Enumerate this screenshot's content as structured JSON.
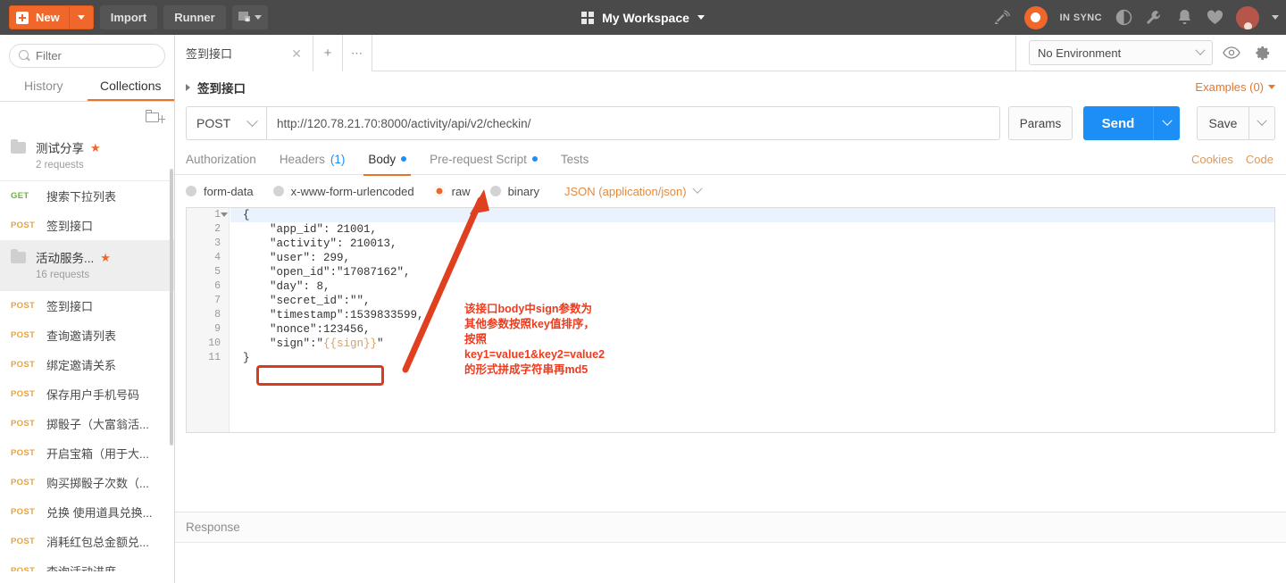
{
  "topbar": {
    "new_label": "New",
    "import_label": "Import",
    "runner_label": "Runner",
    "new_icon": "plus-square-icon",
    "dropdown_icon": "caret-down-icon",
    "import_window_icon": "new-window-icon",
    "workspace_title": "My Workspace",
    "workspace_icon": "grid-icon",
    "workspace_caret": "caret-down-icon",
    "broadcast_icon": "broadcast-icon",
    "sync_icon": "sync-icon",
    "sync_text": "IN SYNC",
    "moon_icon": "moon-icon",
    "wrench_icon": "wrench-icon",
    "bell_icon": "bell-icon",
    "heart_icon": "heart-icon",
    "avatar_icon": "avatar-icon"
  },
  "sidebar": {
    "search_placeholder": "Filter",
    "search_icon": "search-icon",
    "tabs": [
      {
        "label": "History",
        "active": false
      },
      {
        "label": "Collections",
        "active": true
      }
    ],
    "new_folder_icon": "new-folder-icon",
    "collections": [
      {
        "type": "folder",
        "name": "测试分享",
        "requests_label": "2 requests",
        "starred": true,
        "selected": false,
        "star_icon": "star-icon",
        "folder_icon": "folder-icon"
      },
      {
        "type": "request",
        "method": "GET",
        "name": "搜索下拉列表"
      },
      {
        "type": "request",
        "method": "POST",
        "name": "签到接口"
      },
      {
        "type": "folder",
        "name": "活动服务...",
        "requests_label": "16 requests",
        "starred": true,
        "selected": true,
        "star_icon": "star-icon",
        "folder_icon": "folder-icon"
      },
      {
        "type": "request",
        "method": "POST",
        "name": "签到接口"
      },
      {
        "type": "request",
        "method": "POST",
        "name": "查询邀请列表"
      },
      {
        "type": "request",
        "method": "POST",
        "name": "绑定邀请关系"
      },
      {
        "type": "request",
        "method": "POST",
        "name": "保存用户手机号码"
      },
      {
        "type": "request",
        "method": "POST",
        "name": "掷骰子（大富翁活..."
      },
      {
        "type": "request",
        "method": "POST",
        "name": "开启宝箱（用于大..."
      },
      {
        "type": "request",
        "method": "POST",
        "name": "购买掷骰子次数（..."
      },
      {
        "type": "request",
        "method": "POST",
        "name": "兑换 使用道具兑换..."
      },
      {
        "type": "request",
        "method": "POST",
        "name": "消耗红包总金额兑..."
      },
      {
        "type": "request",
        "method": "POST",
        "name": "查询活动进度"
      }
    ]
  },
  "main": {
    "request_tabs": [
      {
        "label": "签到接口",
        "close_icon": "close-icon",
        "active": true
      }
    ],
    "add_tab_icon": "plus-icon",
    "more_tabs_icon": "ellipsis-icon",
    "environment": {
      "selected": "No Environment",
      "caret_icon": "chevron-down-icon",
      "eye_icon": "eye-icon",
      "gear_icon": "gear-icon"
    },
    "breadcrumb": {
      "expand_icon": "triangle-right-icon",
      "title": "签到接口",
      "examples_label": "Examples (0)",
      "examples_caret": "caret-down-icon"
    },
    "request": {
      "method": "POST",
      "method_caret": "chevron-down-icon",
      "url": "http://120.78.21.70:8000/activity/api/v2/checkin/",
      "params_label": "Params",
      "send_label": "Send",
      "send_caret": "chevron-down-icon",
      "save_label": "Save",
      "save_caret": "chevron-down-icon"
    },
    "request_tabs_row": [
      {
        "label": "Authorization",
        "active": false,
        "dot": false,
        "count": null
      },
      {
        "label": "Headers",
        "active": false,
        "dot": false,
        "count": "(1)"
      },
      {
        "label": "Body",
        "active": true,
        "dot": true,
        "count": null
      },
      {
        "label": "Pre-request Script",
        "active": false,
        "dot": true,
        "count": null
      },
      {
        "label": "Tests",
        "active": false,
        "dot": false,
        "count": null
      }
    ],
    "cookies_label": "Cookies",
    "code_label": "Code",
    "body_options": [
      {
        "label": "form-data",
        "selected": false
      },
      {
        "label": "x-www-form-urlencoded",
        "selected": false
      },
      {
        "label": "raw",
        "selected": true
      },
      {
        "label": "binary",
        "selected": false
      }
    ],
    "content_type": "JSON (application/json)",
    "content_type_caret": "chevron-down-icon",
    "editor": {
      "lines": [
        {
          "n": "1",
          "text": "{"
        },
        {
          "n": "2",
          "text": "    \"app_id\": 21001,"
        },
        {
          "n": "3",
          "text": "    \"activity\": 210013,"
        },
        {
          "n": "4",
          "text": "    \"user\": 299,"
        },
        {
          "n": "5",
          "text": "    \"open_id\":\"17087162\","
        },
        {
          "n": "6",
          "text": "    \"day\": 8,"
        },
        {
          "n": "7",
          "text": "    \"secret_id\":\"\","
        },
        {
          "n": "8",
          "text": "    \"timestamp\":1539833599,"
        },
        {
          "n": "9",
          "text": "    \"nonce\":123456,"
        },
        {
          "n": "10",
          "text": "    \"sign\":\"{{sign}}\""
        },
        {
          "n": "11",
          "text": "}"
        }
      ]
    },
    "response_label": "Response"
  },
  "annotations": {
    "note_text": "该接口body中sign参数为其他参数按照key值排序，按照key1=value1&key2=value2的形式拼成字符串再md5",
    "highlight_color": "#d93b1e",
    "note_color": "#ee3b1e",
    "arrow_name": "red-arrow-annotation",
    "box_name": "red-highlight-box"
  }
}
